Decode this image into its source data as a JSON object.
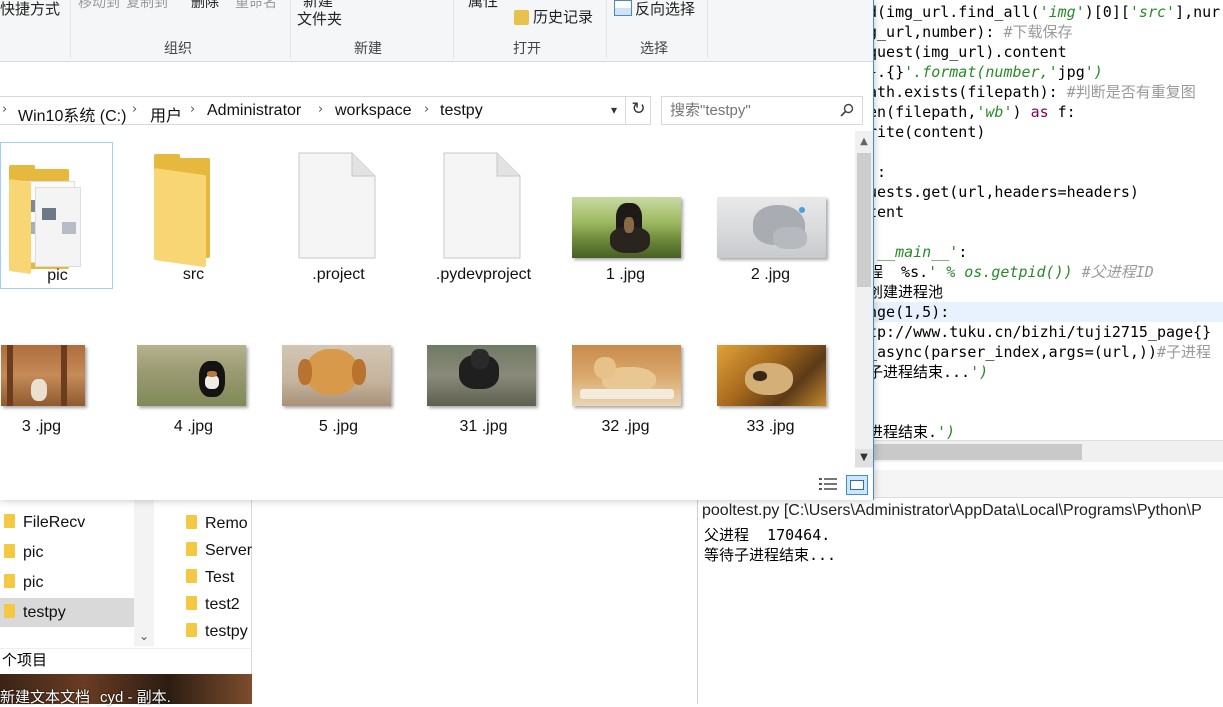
{
  "ribbon": {
    "partial_shortcut": "快捷方式",
    "partial_move": "移动到",
    "partial_copy": "复制到",
    "partial_delete": "删除",
    "partial_rename": "重命名",
    "partial_new_folder_1": "新建",
    "partial_new_folder_2": "文件夹",
    "partial_properties": "属性",
    "history": "历史记录",
    "invert_selection": "反向选择",
    "groups": {
      "organize": "组织",
      "new": "新建",
      "open": "打开",
      "select": "选择"
    }
  },
  "address": {
    "crumbs": [
      "Win10系统 (C:)",
      "用户",
      "Administrator",
      "workspace",
      "testpy"
    ]
  },
  "search": {
    "placeholder": "搜索\"testpy\""
  },
  "items": [
    {
      "name": "pic",
      "type": "folder-with-images",
      "selected": true
    },
    {
      "name": "src",
      "type": "folder"
    },
    {
      "name": ".project",
      "type": "file"
    },
    {
      "name": ".pydevproject",
      "type": "file"
    },
    {
      "name": "1 .jpg",
      "type": "image"
    },
    {
      "name": "2 .jpg",
      "type": "image"
    },
    {
      "name": "3 .jpg",
      "type": "image"
    },
    {
      "name": "4 .jpg",
      "type": "image"
    },
    {
      "name": "5 .jpg",
      "type": "image"
    },
    {
      "name": "31 .jpg",
      "type": "image"
    },
    {
      "name": "32 .jpg",
      "type": "image"
    },
    {
      "name": "33 .jpg",
      "type": "image"
    }
  ],
  "editor": {
    "lines": [
      {
        "t": "d(img_url.find_all('img')[0]['src'],nur"
      },
      {
        "t": "g_url,number): #下载保存"
      },
      {
        "t": "quest(img_url).content"
      },
      {
        "t": "}.{}'.format(number,'jpg')"
      },
      {
        "t": "ath.exists(filepath): #判断是否有重复图"
      },
      {
        "t": "en(filepath,'wb') as f:"
      },
      {
        "t": "rite(content)"
      },
      {
        "t": ""
      },
      {
        "t": "):"
      },
      {
        "t": "uests.get(url,headers=headers)"
      },
      {
        "t": "tent"
      },
      {
        "t": ""
      },
      {
        "t": "'__main__':"
      },
      {
        "t": "程  %s.' % os.getpid()) #父进程ID"
      },
      {
        "t": "创建进程池"
      },
      {
        "t": "nge(1,5):"
      },
      {
        "t": "tp://www.tuku.cn/bizhi/tuji2715_page{}"
      },
      {
        "t": "_async(parser_index,args=(url,))#子进程"
      },
      {
        "t": "子进程结束...')"
      },
      {
        "t": ""
      },
      {
        "t": ""
      },
      {
        "t": "进程结束.')"
      }
    ]
  },
  "console": {
    "title": "pooltest.py [C:\\Users\\Administrator\\AppData\\Local\\Programs\\Python\\P",
    "lines": [
      "父进程  170464.",
      "等待子进程结束..."
    ]
  },
  "nav": {
    "left_items": [
      "FileRecv",
      "pic",
      "pic",
      "testpy"
    ],
    "right_items": [
      "Remo",
      "Server",
      "Test",
      "test2",
      "testpy"
    ],
    "status": "个项目",
    "taskbar_1": "新建文本文档",
    "taskbar_2": "cyd - 副本."
  }
}
